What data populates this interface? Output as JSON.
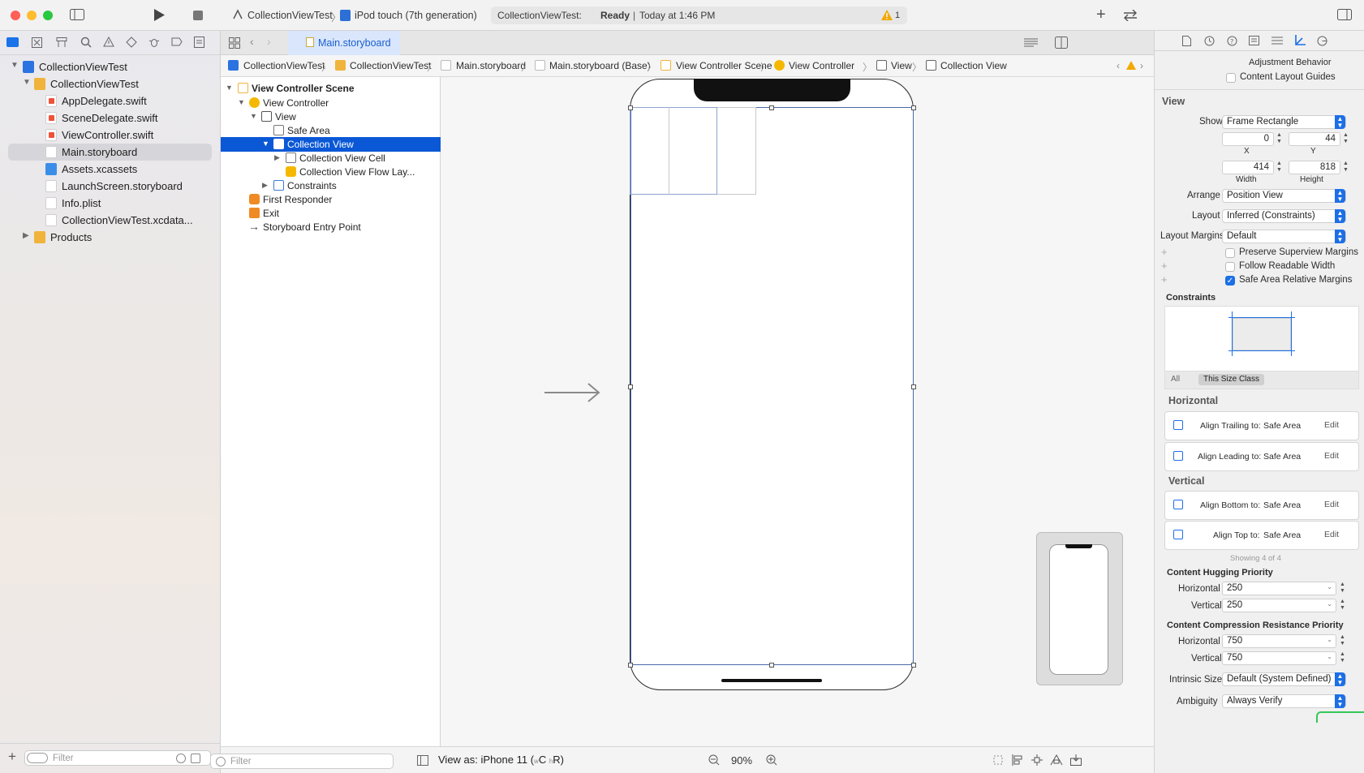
{
  "toolbar": {
    "scheme": "CollectionViewTest",
    "destination": "iPod touch (7th generation)",
    "status_project": "CollectionViewTest:",
    "status_state": "Ready",
    "status_time": "Today at 1:46 PM",
    "warning_count": "1",
    "colors": {
      "close": "#fe5f57",
      "minimize": "#febc2e",
      "zoom": "#28c840"
    }
  },
  "navigator": {
    "items": [
      {
        "label": "CollectionViewTest"
      },
      {
        "label": "CollectionViewTest"
      },
      {
        "label": "AppDelegate.swift"
      },
      {
        "label": "SceneDelegate.swift"
      },
      {
        "label": "ViewController.swift"
      },
      {
        "label": "Main.storyboard"
      },
      {
        "label": "Assets.xcassets"
      },
      {
        "label": "LaunchScreen.storyboard"
      },
      {
        "label": "Info.plist"
      },
      {
        "label": "CollectionViewTest.xcdata..."
      },
      {
        "label": "Products"
      }
    ],
    "filter_placeholder": "Filter"
  },
  "editor": {
    "tab_label": "Main.storyboard",
    "jumpbar": [
      "CollectionViewTest",
      "CollectionViewTest",
      "Main.storyboard",
      "Main.storyboard (Base)",
      "View Controller Scene",
      "View Controller",
      "View",
      "Collection View"
    ],
    "outline": [
      {
        "label": "View Controller Scene"
      },
      {
        "label": "View Controller"
      },
      {
        "label": "View"
      },
      {
        "label": "Safe Area"
      },
      {
        "label": "Collection View"
      },
      {
        "label": "Collection View Cell"
      },
      {
        "label": "Collection View Flow Lay..."
      },
      {
        "label": "Constraints"
      },
      {
        "label": "First Responder"
      },
      {
        "label": "Exit"
      },
      {
        "label": "Storyboard Entry Point"
      }
    ],
    "outline_filter_placeholder": "Filter",
    "view_as": "View as: iPhone 11 (",
    "view_as_w": "w",
    "view_as_c": "C ",
    "view_as_h": "h",
    "view_as_r": "R)",
    "zoom": "90%"
  },
  "inspector": {
    "adjust_behavior": "Adjustment Behavior",
    "content_layout_guides": "Content Layout Guides",
    "view_title": "View",
    "show_label": "Show",
    "show_value": "Frame Rectangle",
    "x_value": "0",
    "y_value": "44",
    "x_label": "X",
    "y_label": "Y",
    "width_value": "414",
    "height_value": "818",
    "width_label": "Width",
    "height_label": "Height",
    "arrange_label": "Arrange",
    "arrange_value": "Position View",
    "layout_label": "Layout",
    "layout_value": "Inferred (Constraints)",
    "layout_margins_label": "Layout Margins",
    "layout_margins_value": "Default",
    "preserve_superview": "Preserve Superview Margins",
    "follow_readable": "Follow Readable Width",
    "safe_area_relative": "Safe Area Relative Margins",
    "constraints_title": "Constraints",
    "seg_all": "All",
    "seg_size_class": "This Size Class",
    "horizontal_title": "Horizontal",
    "vertical_title": "Vertical",
    "constraints": [
      {
        "label": "Align Trailing to:",
        "target": "Safe Area",
        "edit": "Edit"
      },
      {
        "label": "Align Leading to:",
        "target": "Safe Area",
        "edit": "Edit"
      },
      {
        "label": "Align Bottom to:",
        "target": "Safe Area",
        "edit": "Edit"
      },
      {
        "label": "Align Top to:",
        "target": "Safe Area",
        "edit": "Edit"
      }
    ],
    "showing": "Showing 4 of 4",
    "hugging_title": "Content Hugging Priority",
    "hugging_h_label": "Horizontal",
    "hugging_h_value": "250",
    "hugging_v_label": "Vertical",
    "hugging_v_value": "250",
    "compression_title": "Content Compression Resistance Priority",
    "compression_h_label": "Horizontal",
    "compression_h_value": "750",
    "compression_v_label": "Vertical",
    "compression_v_value": "750",
    "intrinsic_label": "Intrinsic Size",
    "intrinsic_value": "Default (System Defined)",
    "ambiguity_label": "Ambiguity",
    "ambiguity_value": "Always Verify",
    "accent": "#1c6fe6"
  }
}
